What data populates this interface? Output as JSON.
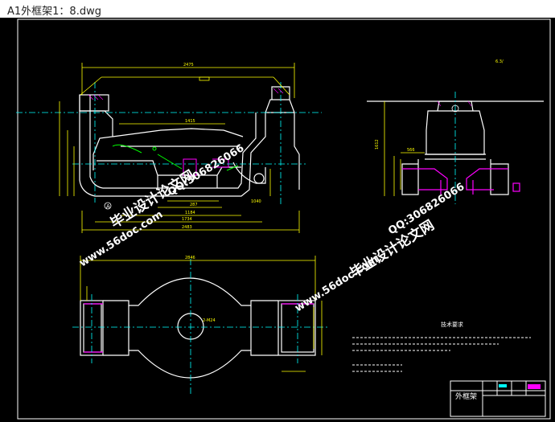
{
  "window": {
    "title": "A1外框架1：8.dwg"
  },
  "colors": {
    "background": "#000000",
    "outline": "#ffffff",
    "dimension": "#ffff00",
    "section": "#ff00ff",
    "centerline": "#00ffff",
    "weld": "#00ff00",
    "watermark": "#ffffff"
  },
  "drawing": {
    "tech_req_title": "技术要求",
    "title_block_name": "外框架",
    "front_view_label": "A",
    "watermarks": [
      {
        "text": "毕业设计论文网"
      },
      {
        "text": "www.56doc.com"
      },
      {
        "text": "QQ:306826066"
      },
      {
        "text": "www.56doc.com"
      },
      {
        "text": "QQ:306826066"
      },
      {
        "text": "毕业设计论文网"
      }
    ]
  }
}
